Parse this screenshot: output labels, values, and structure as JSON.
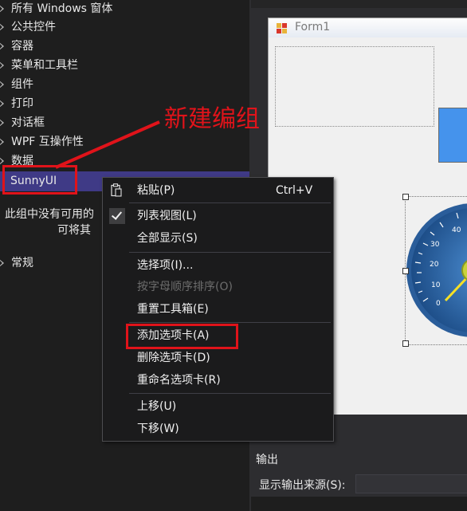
{
  "toolbox": {
    "groups": [
      {
        "label": "所有 Windows 窗体"
      },
      {
        "label": "公共控件"
      },
      {
        "label": "容器"
      },
      {
        "label": "菜单和工具栏"
      },
      {
        "label": "组件"
      },
      {
        "label": "打印"
      },
      {
        "label": "对话框"
      },
      {
        "label": "WPF 互操作性"
      },
      {
        "label": "数据"
      },
      {
        "label": "SunnyUI"
      },
      {
        "label": "常规"
      }
    ],
    "empty_message_line1": "此组中没有可用的",
    "empty_message_line2": "可将其"
  },
  "designer": {
    "form_title": "Form1"
  },
  "annotation": {
    "text": "新建编组",
    "color": "#e0131a"
  },
  "context_menu": {
    "paste": {
      "label": "粘贴(P)",
      "shortcut": "Ctrl+V"
    },
    "list_view": {
      "label": "列表视图(L)",
      "checked": true
    },
    "show_all": {
      "label": "全部显示(S)"
    },
    "choose_items": {
      "label": "选择项(I)..."
    },
    "sort_alpha": {
      "label": "按字母顺序排序(O)",
      "disabled": true
    },
    "reset_toolbox": {
      "label": "重置工具箱(E)"
    },
    "add_tab": {
      "label": "添加选项卡(A)"
    },
    "delete_tab": {
      "label": "删除选项卡(D)"
    },
    "rename_tab": {
      "label": "重命名选项卡(R)"
    },
    "move_up": {
      "label": "上移(U)"
    },
    "move_down": {
      "label": "下移(W)"
    }
  },
  "output": {
    "title": "输出",
    "source_label": "显示输出来源(S):",
    "source_value": ""
  },
  "gauge": {
    "tick_labels": [
      "40",
      "30",
      "20",
      "10",
      "0"
    ]
  },
  "colors": {
    "selection": "#3f3a86",
    "background": "#1e1e1e",
    "accent_red": "#e0131a",
    "button_blue": "#4593ec"
  }
}
